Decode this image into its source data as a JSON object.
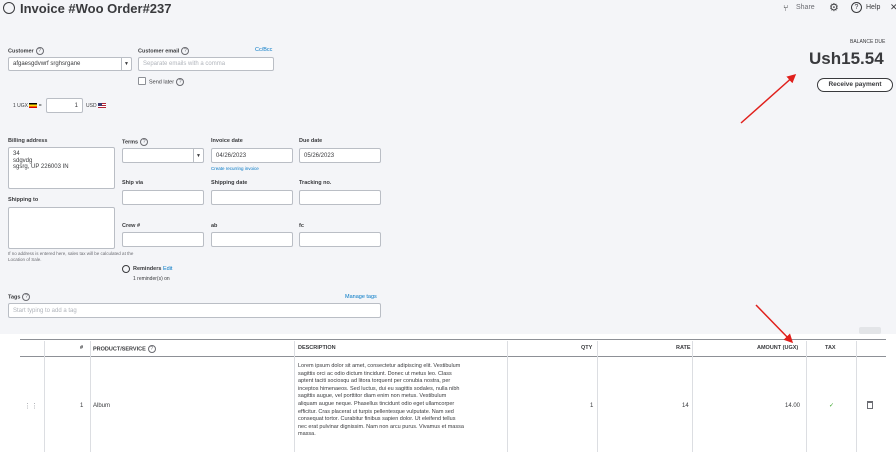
{
  "header": {
    "title": "Invoice #Woo Order#237",
    "share_label": "Share",
    "help_label": "Help"
  },
  "customer": {
    "label": "Customer",
    "value": "afgaesgdvwrf srghsrgane",
    "email_label": "Customer email",
    "cc_bcc": "Cc/Bcc",
    "email_placeholder": "Separate emails with a comma",
    "send_later": "Send later"
  },
  "currency": {
    "left": "1 UGX",
    "eq": "=",
    "rate_value": "1",
    "right": "USD"
  },
  "balance": {
    "label": "BALANCE DUE",
    "amount": "Ush15.54",
    "receive_payment": "Receive payment"
  },
  "billing": {
    "label": "Billing address",
    "line1": "34",
    "line2": "sdgvdg",
    "line3": "sgsrg, UP 226003 IN",
    "shipping_label": "Shipping to",
    "note": "If no address is entered here, sales tax will be calculated at the Location of Sale."
  },
  "terms": {
    "terms_label": "Terms",
    "invoice_date_label": "Invoice date",
    "invoice_date": "04/26/2023",
    "recurring_link": "Create recurring invoice",
    "due_date_label": "Due date",
    "due_date": "05/26/2023",
    "ship_via_label": "Ship via",
    "shipping_date_label": "Shipping date",
    "tracking_label": "Tracking no.",
    "crew_label": "Crew #",
    "ab_label": "ab",
    "fc_label": "fc"
  },
  "reminders": {
    "label": "Reminders",
    "edit": "Edit",
    "count": "1 reminder(s) on"
  },
  "tags": {
    "label": "Tags",
    "manage": "Manage tags",
    "placeholder": "Start typing to add a tag"
  },
  "table": {
    "headers": {
      "num": "#",
      "product": "PRODUCT/SERVICE",
      "description": "DESCRIPTION",
      "qty": "QTY",
      "rate": "RATE",
      "amount": "AMOUNT (UGX)",
      "tax": "TAX"
    },
    "rows": [
      {
        "num": "1",
        "product": "Album",
        "description": [
          "Lorem ipsum dolor sit amet, consectetur adipiscing elit. Vestibulum",
          "sagittis orci ac odio dictum tincidunt. Donec ut metus leo. Class",
          "aptent taciti sociosqu ad litora torquent per conubia nostra, per",
          "inceptos himenaeos. Sed luctus, dui eu sagittis sodales, nulla nibh",
          "sagittis augue, vel porttitor diam enim non metus. Vestibulum",
          "aliquam augue neque. Phasellus tincidunt odio eget ullamcorper",
          "efficitur. Cras placerat ut turpis pellentesque vulputate. Nam sed",
          "consequat tortor. Curabitur finibus sapien dolor. Ut eleifend tellus",
          "nec erat pulvinar dignissim. Nam non arcu purus. Vivamus et massa",
          "massa."
        ],
        "qty": "1",
        "rate": "14",
        "amount": "14.00",
        "tax": "✓"
      }
    ]
  },
  "colors": {
    "accent": "#0077c5",
    "arrow": "#e0201c",
    "check": "#2ca01c"
  }
}
